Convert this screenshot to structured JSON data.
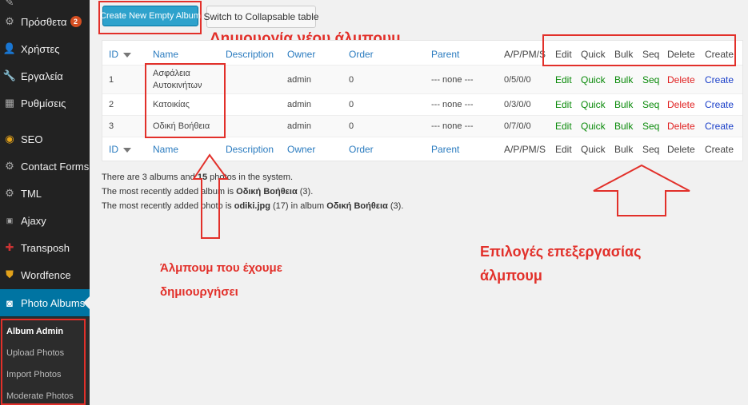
{
  "sidebar": {
    "items": [
      {
        "icon": "pin-icon",
        "label": ""
      },
      {
        "icon": "plugins-icon",
        "label": "Πρόσθετα",
        "badge": "2"
      },
      {
        "icon": "users-icon",
        "label": "Χρήστες"
      },
      {
        "icon": "wrench-icon",
        "label": "Εργαλεία"
      },
      {
        "icon": "settings-icon",
        "label": "Ρυθμίσεις"
      },
      {
        "icon": "seo-icon",
        "label": "SEO"
      },
      {
        "icon": "contact-forms-icon",
        "label": "Contact Forms"
      },
      {
        "icon": "tml-icon",
        "label": "TML"
      },
      {
        "icon": "ajaxy-icon",
        "label": "Ajaxy"
      },
      {
        "icon": "transposh-icon",
        "label": "Transposh"
      },
      {
        "icon": "wordfence-icon",
        "label": "Wordfence"
      },
      {
        "icon": "camera-icon",
        "label": "Photo Albums"
      }
    ],
    "submenu": [
      "Album Admin",
      "Upload Photos",
      "Import Photos",
      "Moderate Photos"
    ]
  },
  "toolbar": {
    "create_label": "Create New Empty Album",
    "switch_label": "Switch to Collapsable table"
  },
  "table": {
    "headers": {
      "id": "ID",
      "name": "Name",
      "description": "Description",
      "owner": "Owner",
      "order": "Order",
      "parent": "Parent",
      "apm": "A/P/PM/S",
      "edit": "Edit",
      "quick": "Quick",
      "bulk": "Bulk",
      "seq": "Seq",
      "delete": "Delete",
      "create": "Create"
    },
    "rows": [
      {
        "id": "1",
        "name_line1": "Ασφάλεια",
        "name_line2": "Αυτοκινήτων",
        "owner": "admin",
        "order": "0",
        "parent": "--- none ---",
        "apm": "0/5/0/0"
      },
      {
        "id": "2",
        "name_line1": "Κατοικίας",
        "name_line2": "",
        "owner": "admin",
        "order": "0",
        "parent": "--- none ---",
        "apm": "0/3/0/0"
      },
      {
        "id": "3",
        "name_line1": "Οδική Βοήθεια",
        "name_line2": "",
        "owner": "admin",
        "order": "0",
        "parent": "--- none ---",
        "apm": "0/7/0/0"
      }
    ],
    "actions": {
      "edit": "Edit",
      "quick": "Quick",
      "bulk": "Bulk",
      "seq": "Seq",
      "delete": "Delete",
      "create": "Create"
    }
  },
  "info": {
    "line1_a": "There are 3 albums and ",
    "line1_b": "15",
    "line1_c": " photos in the system.",
    "line2_a": "The most recently added album is ",
    "line2_b": "Οδική Βοήθεια",
    "line2_c": " (3).",
    "line3_a": "The most recently added photo is ",
    "line3_b": "odiki.jpg",
    "line3_c": " (17) in album ",
    "line3_d": "Οδική Βοήθεια",
    "line3_e": " (3)."
  },
  "annotations": {
    "create_album": "Δημιουργία νέου άλμπουμ",
    "created_line1": "Άλμπουμ που έχουμε",
    "created_line2": "δημιουργήσει",
    "edit_line1": "Επιλογές επεξεργασίας",
    "edit_line2": "άλμπουμ"
  },
  "colors": {
    "annotation": "#e2302a",
    "primary": "#2ea2cc",
    "sidebar": "#222222",
    "active": "#0074a2"
  }
}
